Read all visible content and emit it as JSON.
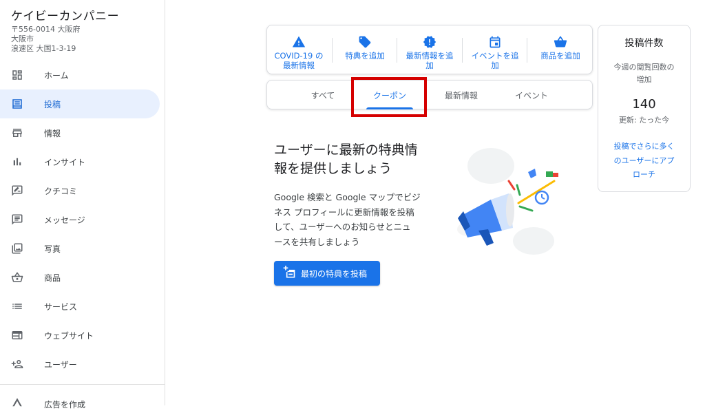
{
  "business": {
    "name": "ケイビーカンパニー",
    "address_line1": "〒556-0014 大阪府",
    "address_line2": "大阪市",
    "address_line3": "浪速区 大国1-3-19"
  },
  "sidebar": {
    "items": [
      {
        "label": "ホーム",
        "icon": "dashboard-icon"
      },
      {
        "label": "投稿",
        "icon": "post-icon",
        "active": true
      },
      {
        "label": "情報",
        "icon": "storefront-icon"
      },
      {
        "label": "インサイト",
        "icon": "bar-chart-icon"
      },
      {
        "label": "クチコミ",
        "icon": "rate-review-icon"
      },
      {
        "label": "メッセージ",
        "icon": "message-icon"
      },
      {
        "label": "写真",
        "icon": "photo-library-icon"
      },
      {
        "label": "商品",
        "icon": "shopping-basket-icon"
      },
      {
        "label": "サービス",
        "icon": "list-icon"
      },
      {
        "label": "ウェブサイト",
        "icon": "web-icon"
      },
      {
        "label": "ユーザー",
        "icon": "person-add-icon"
      }
    ],
    "bottom_item": {
      "label": "広告を作成",
      "icon": "google-ads-icon"
    }
  },
  "actions": [
    {
      "line1": "COVID-19 の",
      "line2": "最新情報",
      "icon": "warning-icon"
    },
    {
      "line1": "特典を追加",
      "line2": "",
      "icon": "offer-tag-icon"
    },
    {
      "line1": "最新情報を追",
      "line2": "加",
      "icon": "update-badge-icon"
    },
    {
      "line1": "イベントを追",
      "line2": "加",
      "icon": "event-icon"
    },
    {
      "line1": "商品を追加",
      "line2": "",
      "icon": "shopping-basket-icon"
    }
  ],
  "tabs": [
    {
      "label": "すべて"
    },
    {
      "label": "クーポン",
      "active": true
    },
    {
      "label": "最新情報"
    },
    {
      "label": "イベント"
    }
  ],
  "promo": {
    "title_line1": "ユーザーに最新の特典情",
    "title_line2": "報を提供しましょう",
    "desc_line1": "Google 検索と Google マップでビジ",
    "desc_line2": "ネス プロフィールに更新情報を投稿",
    "desc_line3": "して、ユーザーへのお知らせとニュ",
    "desc_line4": "ースを共有しましょう",
    "cta_label": "最初の特典を投稿"
  },
  "stats": {
    "title": "投稿件数",
    "subtitle_line1": "今週の閲覧回数の",
    "subtitle_line2": "増加",
    "value": "140",
    "updated": "更新: たった今",
    "link_line1": "投稿でさらに多く",
    "link_line2": "のユーザーにアプ",
    "link_line3": "ローチ"
  },
  "colors": {
    "accent": "#1a73e8",
    "active_nav_bg": "#e8f0fe",
    "highlight_box": "#d50000"
  }
}
